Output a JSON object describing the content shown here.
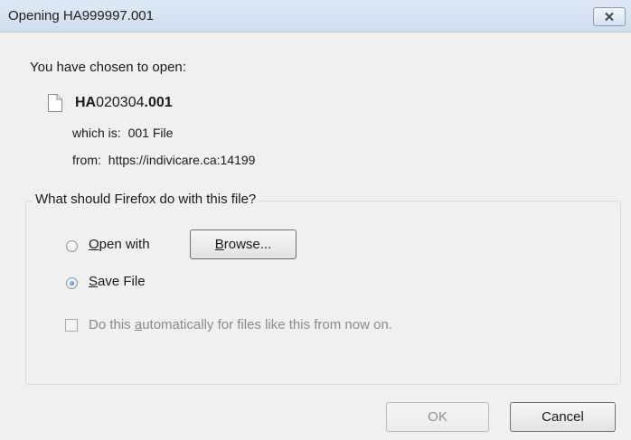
{
  "window": {
    "title": "Opening HA999997.001",
    "close_icon": "close-icon"
  },
  "dialog": {
    "intro": "You have chosen to open:",
    "file": {
      "icon": "document-icon",
      "name_prefix": "HA",
      "name_middle": "020304",
      "name_suffix": ".001",
      "type_label": "which is:",
      "type_value": "001 File",
      "from_label": "from:",
      "from_value": "https://indivicare.ca:14199"
    },
    "group_title": "What should Firefox do with this file?",
    "options": {
      "open_with": {
        "mnemonic": "O",
        "rest": "pen with",
        "selected": false
      },
      "browse_button": {
        "mnemonic": "B",
        "rest": "rowse..."
      },
      "save_file": {
        "mnemonic": "S",
        "rest": "ave File",
        "selected": true
      },
      "auto": {
        "before": "Do this ",
        "mnemonic": "a",
        "after": "utomatically for files like this from now on.",
        "checked": false,
        "enabled": false
      }
    },
    "buttons": {
      "ok": "OK",
      "cancel": "Cancel"
    }
  }
}
